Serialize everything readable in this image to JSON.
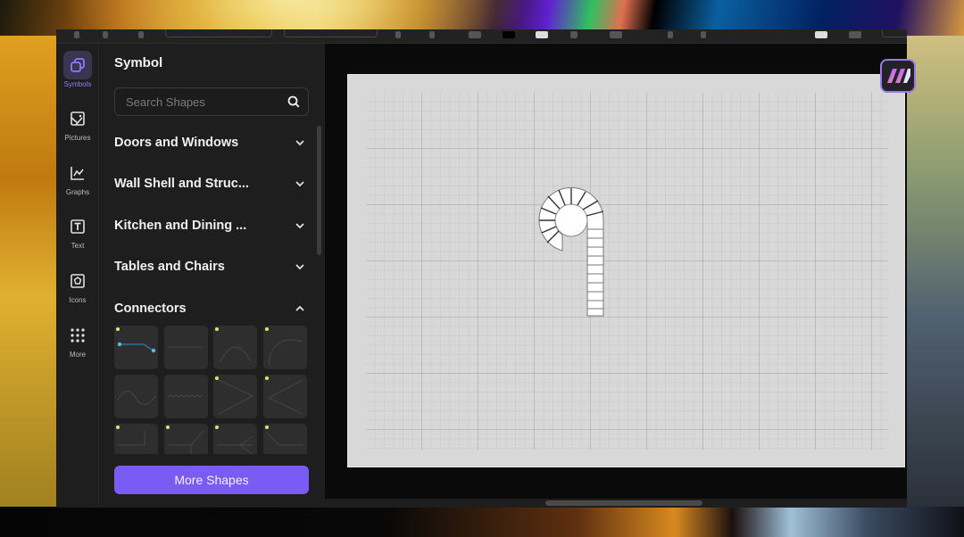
{
  "rail": {
    "items": [
      {
        "label": "Symbols",
        "icon": "symbols-icon",
        "active": true
      },
      {
        "label": "Pictures",
        "icon": "pictures-icon",
        "active": false
      },
      {
        "label": "Graphs",
        "icon": "graphs-icon",
        "active": false
      },
      {
        "label": "Text",
        "icon": "text-icon",
        "active": false
      },
      {
        "label": "Icons",
        "icon": "icons-icon",
        "active": false
      },
      {
        "label": "More",
        "icon": "more-grid-icon",
        "active": false
      }
    ]
  },
  "panel": {
    "title": "Symbol",
    "search": {
      "placeholder": "Search Shapes",
      "value": ""
    },
    "categories": [
      {
        "label": "Doors and Windows",
        "expanded": false
      },
      {
        "label": "Wall Shell and Struc...",
        "expanded": false
      },
      {
        "label": "Kitchen and Dining ...",
        "expanded": false
      },
      {
        "label": "Tables and Chairs",
        "expanded": false
      },
      {
        "label": "Connectors",
        "expanded": true
      }
    ],
    "connector_shapes": [
      "elbow-connector",
      "straight-connector",
      "arc-connector",
      "curved-connector",
      "wave-connector",
      "zigzag-connector",
      "angle-connector",
      "reverse-angle-connector",
      "right-angle-connector",
      "branch-connector",
      "arrow-connector",
      "bent-connector"
    ],
    "more_button": "More Shapes"
  },
  "canvas": {
    "shape": "spiral-staircase"
  },
  "colors": {
    "accent": "#7a5cf5",
    "active_rail": "#8f7bff",
    "canvas_bg": "#d8d8d8",
    "dark_bg": "#1e1e1e"
  }
}
